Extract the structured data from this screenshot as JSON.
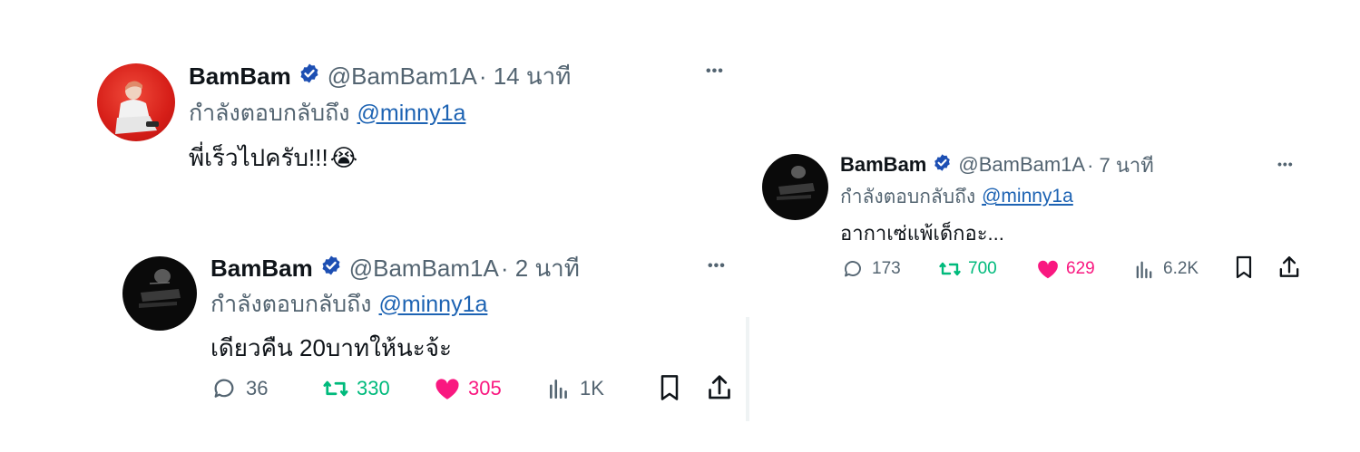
{
  "tweets": [
    {
      "name": "BamBam",
      "handle": "@BamBam1A",
      "time": "· 14 นาที",
      "reply_prefix": "กำลังตอบกลับถึง",
      "reply_to": "@minny1a",
      "text": "พี่เร็วไปครับ!!!",
      "emoji": "😭",
      "more": "•••"
    },
    {
      "name": "BamBam",
      "handle": "@BamBam1A",
      "time": "· 2 นาที",
      "reply_prefix": "กำลังตอบกลับถึง",
      "reply_to": "@minny1a",
      "text": "เดียวคืน 20บาทให้นะจ้ะ",
      "more": "•••",
      "replies": "36",
      "retweets": "330",
      "likes": "305",
      "views": "1K"
    },
    {
      "name": "BamBam",
      "handle": "@BamBam1A",
      "time": "· 7 นาที",
      "reply_prefix": "กำลังตอบกลับถึง",
      "reply_to": "@minny1a",
      "text": "อากาเซ่แพ้เด็กอะ...",
      "more": "•••",
      "replies": "173",
      "retweets": "700",
      "likes": "629",
      "views": "6.2K"
    }
  ],
  "colors": {
    "verified": "#1d4fb3",
    "retweet": "#00ba7c",
    "like": "#f91880",
    "mention": "#1d63b3",
    "muted": "#536471"
  },
  "icons": [
    "verified-badge-icon",
    "more-icon",
    "reply-icon",
    "retweet-icon",
    "like-icon",
    "views-icon",
    "bookmark-icon",
    "share-icon"
  ]
}
